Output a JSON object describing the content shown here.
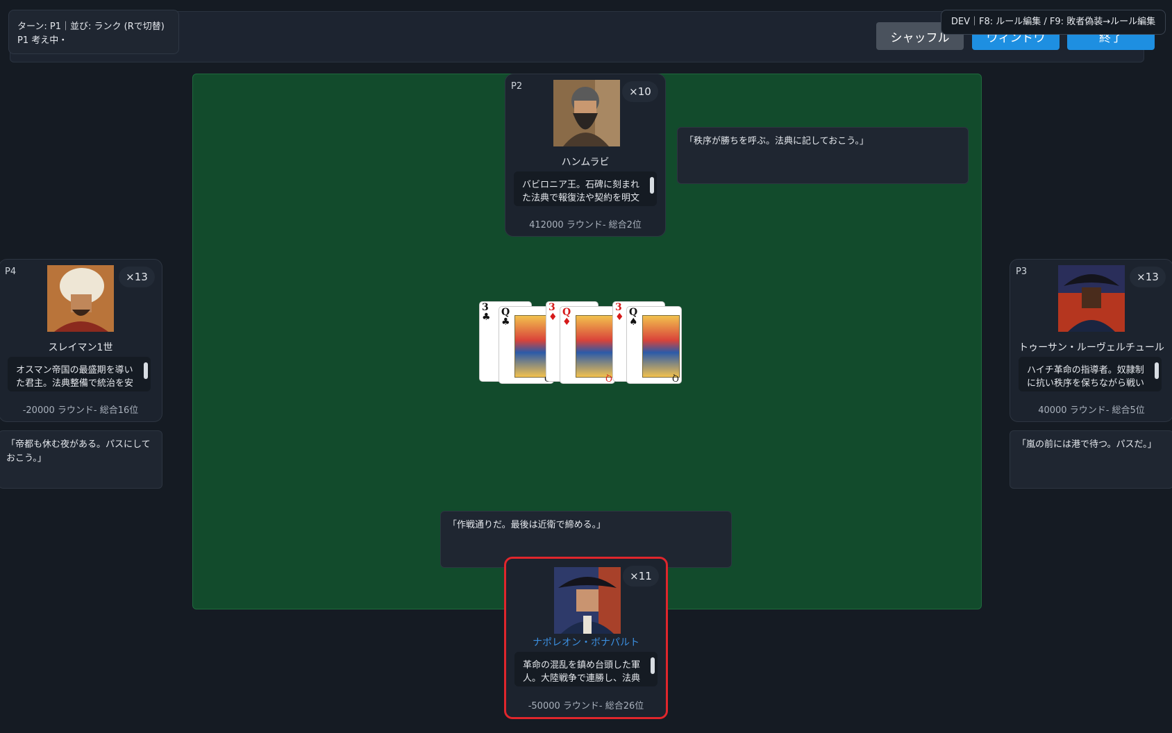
{
  "status": {
    "line1": "ターン: P1｜並び: ランク (Rで切替)",
    "line2": "P1 考え中・"
  },
  "buttons": {
    "shuffle": "シャッフル",
    "window": "ウィンドウ",
    "end": "終了"
  },
  "dev": "DEV｜F8: ルール編集 / F9: 敗者偽装→ルール編集",
  "players": {
    "p2": {
      "tag": "P2",
      "count": "×10",
      "name": "ハンムラビ",
      "bio": "バビロニア王。石碑に刻まれた法典で報復法や契約を明文",
      "score": "412000 ラウンド- 総合2位",
      "speech": "「秩序が勝ちを呼ぶ。法典に記しておこう。」"
    },
    "p4": {
      "tag": "P4",
      "count": "×13",
      "name": "スレイマン1世",
      "bio": "オスマン帝国の最盛期を導いた君主。法典整備で統治を安",
      "score": "-20000 ラウンド- 総合16位",
      "speech": "「帝都も休む夜がある。パスにしておこう。」"
    },
    "p3": {
      "tag": "P3",
      "count": "×13",
      "name": "トゥーサン・ルーヴェルチュール",
      "bio": "ハイチ革命の指導者。奴隷制に抗い秩序を保ちながら戦い",
      "score": "40000 ラウンド- 総合5位",
      "speech": "「嵐の前には港で待つ。パスだ。」"
    },
    "p1": {
      "count": "×11",
      "name": "ナポレオン・ボナパルト",
      "bio": "革命の混乱を鎮め台頭した軍人。大陸戦争で連勝し、法典",
      "score": "-50000 ラウンド- 総合26位",
      "speech": "「作戦通りだ。最後は近衛で締める。」"
    }
  },
  "played_cards": [
    {
      "back_rank": "3",
      "back_suit": "♣",
      "rank": "Q",
      "suit": "♣",
      "color": "#111111"
    },
    {
      "back_rank": "3",
      "back_suit": "♦",
      "rank": "Q",
      "suit": "♦",
      "color": "#d61a1a"
    },
    {
      "back_rank": "3",
      "back_suit": "♦",
      "rank": "Q",
      "suit": "♠",
      "color": "#111111"
    }
  ],
  "colors": {
    "felt": "#124b2c",
    "accent": "#1e8fe1",
    "active_border": "#e0262c",
    "self_name": "#3b8fe0"
  },
  "icons": {
    "p2_portrait": "bearded-man-portrait",
    "p4_portrait": "turban-sultan-portrait",
    "p3_portrait": "bicorne-general-portrait",
    "p1_portrait": "napoleon-portrait"
  }
}
